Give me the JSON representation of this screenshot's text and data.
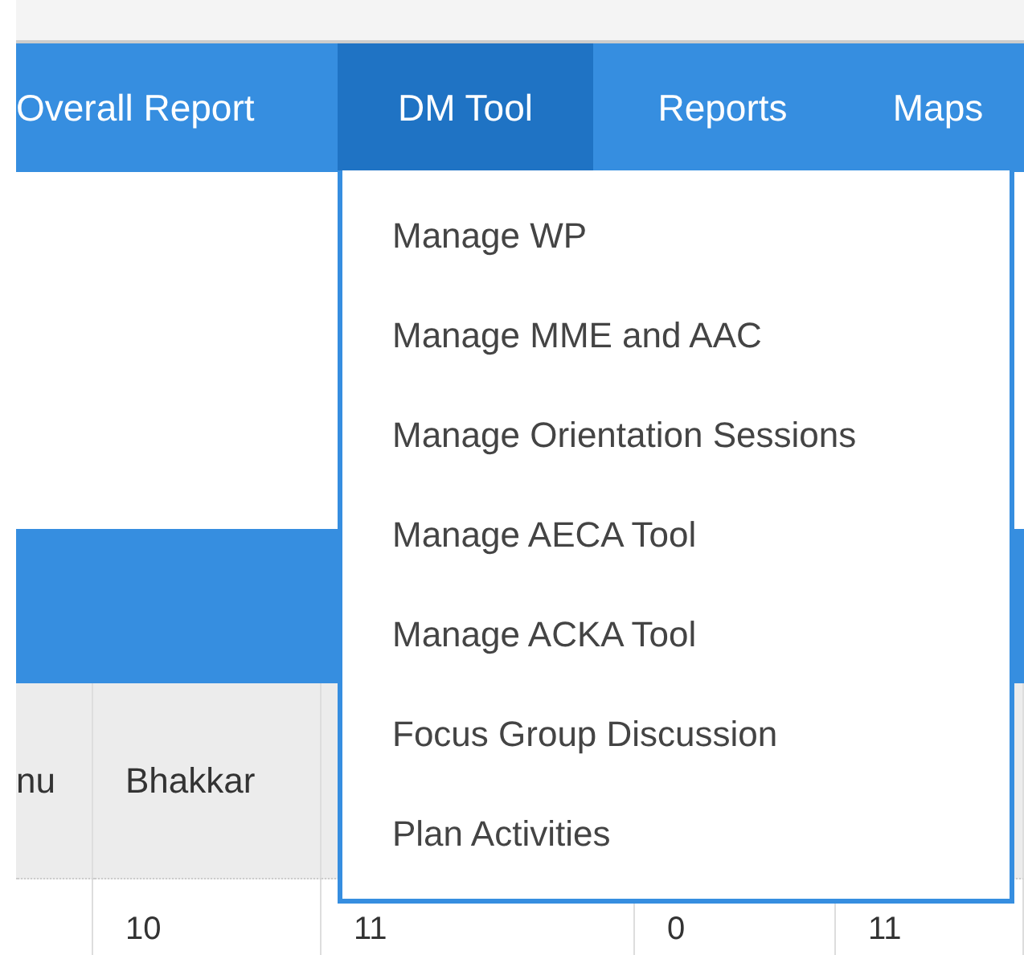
{
  "nav": {
    "items": [
      {
        "label": "Overall Report",
        "selected": false
      },
      {
        "label": "DM Tool",
        "selected": true
      },
      {
        "label": "Reports",
        "selected": false
      },
      {
        "label": "Maps",
        "selected": false
      }
    ]
  },
  "dropdown": {
    "items": [
      "Manage WP",
      "Manage MME and AAC",
      "Manage Orientation Sessions",
      "Manage AECA Tool",
      "Manage ACKA Tool",
      "Focus Group Discussion",
      "Plan Activities"
    ]
  },
  "table": {
    "header": [
      "nu",
      "Bhakkar"
    ],
    "rows": [
      [
        "",
        "10",
        "11",
        "0",
        "11"
      ]
    ]
  }
}
